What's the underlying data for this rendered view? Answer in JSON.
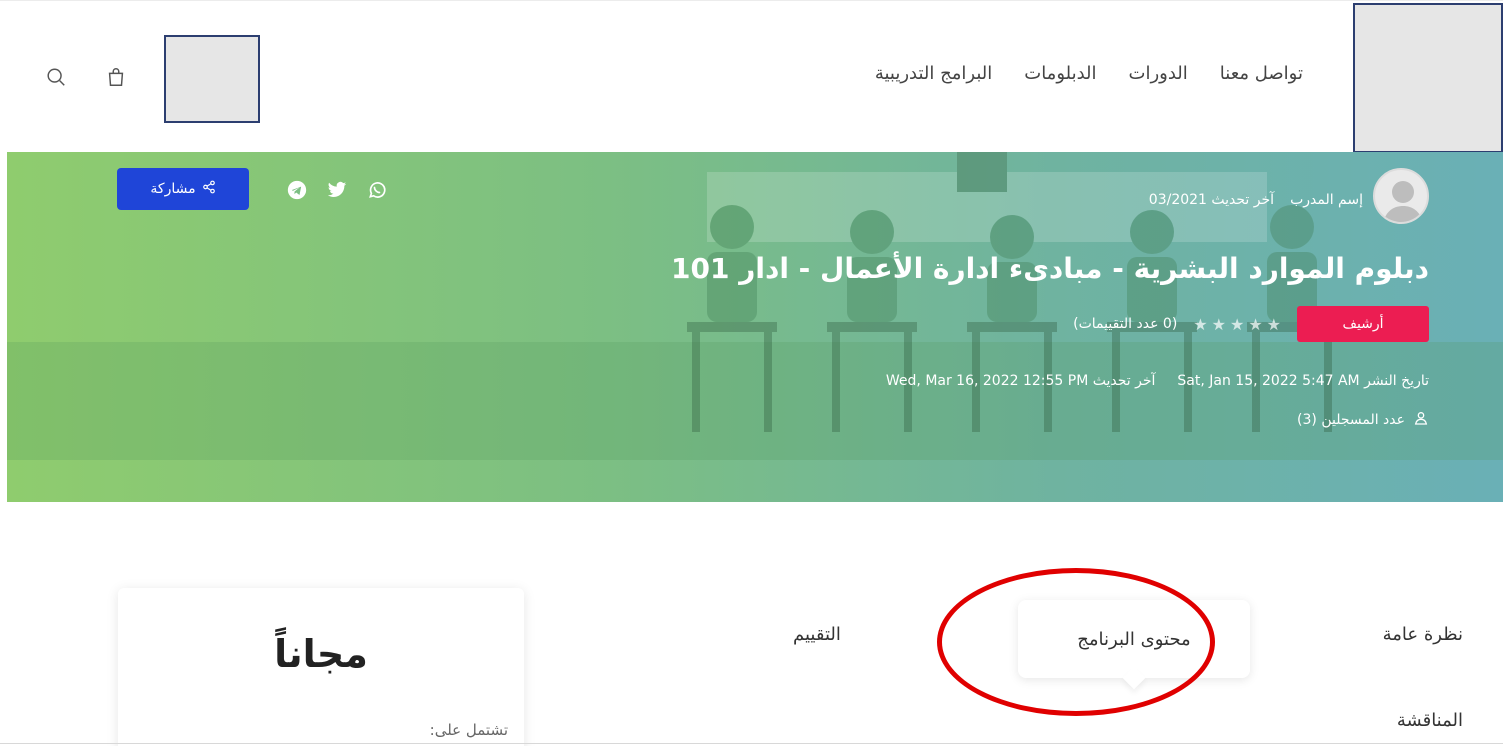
{
  "header": {
    "nav": [
      "البرامج التدريبية",
      "الدبلومات",
      "الدورات",
      "تواصل معنا"
    ],
    "icons": [
      "search-icon",
      "shopping-bag-icon"
    ]
  },
  "hero": {
    "share_label": "مشاركة",
    "socials": [
      "whatsapp-icon",
      "twitter-icon",
      "telegram-icon"
    ],
    "trainer_name": "إسم المدرب",
    "last_update_short": "آخر تحديث 03/2021",
    "title": "دبلوم الموارد البشرية - مبادىء ادارة الأعمال - ادار 101",
    "badge": "أرشيف",
    "rating_value": 0,
    "rating_max": 5,
    "rating_count": "(0 عدد التقييمات)",
    "published_label": "تاريخ النشر",
    "published_date": "Sat, Jan 15, 2022 5:47 AM",
    "updated_label": "آخر تحديث",
    "updated_date": "Wed, Mar 16, 2022 12:55 PM",
    "enrolled": "عدد المسجلين (3)"
  },
  "tabs": {
    "overview": "نظرة عامة",
    "content": "محتوى البرنامج",
    "rating": "التقييم",
    "discussion": "المناقشة"
  },
  "price_card": {
    "price": "مجاناً",
    "includes": "تشتمل على:"
  },
  "colors": {
    "share_button": "#1f45d8",
    "badge": "#ec1d52",
    "highlight": "#e00000"
  }
}
